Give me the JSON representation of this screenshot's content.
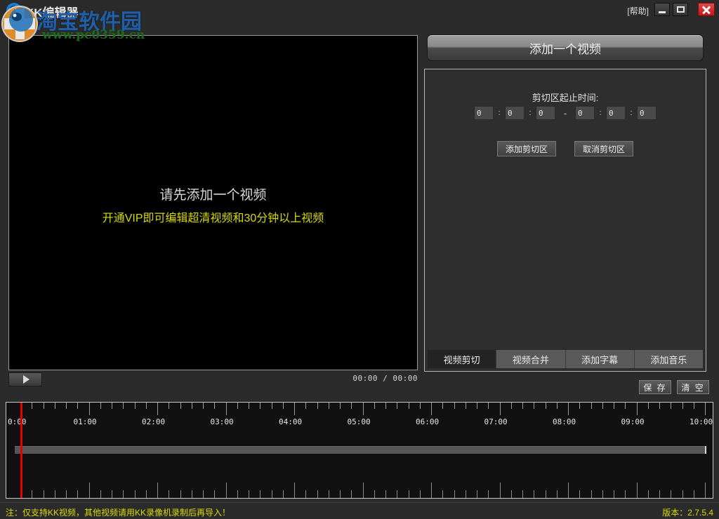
{
  "window": {
    "app_title": "KK编辑器",
    "help_label": "[帮助]",
    "minimize_icon": "minimize-icon",
    "maximize_icon": "maximize-icon",
    "close_icon": "close-icon"
  },
  "watermark": {
    "line1": "淘宝软件园",
    "line2": "www.pc0359.cn"
  },
  "video": {
    "message_main": "请先添加一个视频",
    "message_vip": "开通VIP即可编辑超清视频和30分钟以上视频",
    "vip_color": "#d9d900"
  },
  "player": {
    "play_icon": "play-icon",
    "time_display": "00:00 / 00:00",
    "current_time": "00:00",
    "total_time": "00:00"
  },
  "right_panel": {
    "add_video_label": "添加一个视频",
    "clip_time_label": "剪切区起止时间:",
    "time_inputs": [
      {
        "name": "start-hours",
        "value": "0"
      },
      {
        "name": "start-minutes",
        "value": "0"
      },
      {
        "name": "start-seconds",
        "value": "0"
      },
      {
        "name": "end-hours",
        "value": "0"
      },
      {
        "name": "end-minutes",
        "value": "0"
      },
      {
        "name": "end-seconds",
        "value": "0"
      }
    ],
    "separator_colon": ":",
    "separator_dash": "-",
    "add_clip_label": "添加剪切区",
    "cancel_clip_label": "取消剪切区",
    "tabs": [
      {
        "label": "视频剪切",
        "active": true
      },
      {
        "label": "视频合并",
        "active": false
      },
      {
        "label": "添加字幕",
        "active": false
      },
      {
        "label": "添加音乐",
        "active": false
      }
    ],
    "save_label": "保 存",
    "clear_label": "清 空"
  },
  "timeline": {
    "labels": [
      "0:00",
      "01:00",
      "02:00",
      "03:00",
      "04:00",
      "05:00",
      "06:00",
      "07:00",
      "08:00",
      "09:00",
      "10:00"
    ],
    "playhead_position": "0:00",
    "playhead_color": "#e60000",
    "minor_ticks_per_major": 5
  },
  "statusbar": {
    "note": "注：仅支持KK视频，其他视频请用KK录像机录制后再导入！",
    "version": "版本：2.7.5.4",
    "text_color": "#d9d900"
  }
}
